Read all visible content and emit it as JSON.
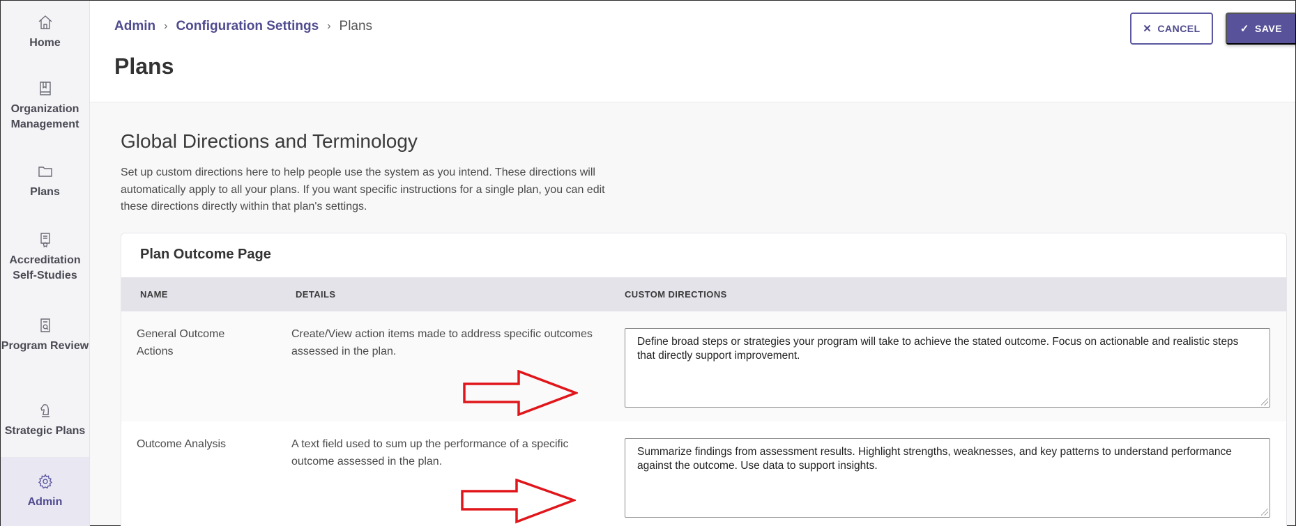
{
  "sidebar": {
    "items": [
      {
        "label": "Home",
        "icon": "home-icon"
      },
      {
        "label": "Organization Management",
        "icon": "book-icon"
      },
      {
        "label": "Plans",
        "icon": "folder-icon"
      },
      {
        "label": "Accreditation Self-Studies",
        "icon": "certificate-icon"
      },
      {
        "label": "Program Review",
        "icon": "document-search-icon"
      },
      {
        "label": "Strategic Plans",
        "icon": "chess-knight-icon"
      },
      {
        "label": "Admin",
        "icon": "gear-icon",
        "active": true
      }
    ]
  },
  "breadcrumb": {
    "admin": "Admin",
    "config": "Configuration Settings",
    "current": "Plans",
    "separator": "›"
  },
  "header": {
    "title": "Plans",
    "cancel_label": "CANCEL",
    "save_label": "SAVE"
  },
  "section": {
    "title": "Global Directions and Terminology",
    "description": "Set up custom directions here to help people use the system as you intend. These directions will automatically apply to all your plans. If you want specific instructions for a single plan, you can edit these directions directly within that plan's settings."
  },
  "card": {
    "title": "Plan Outcome Page",
    "columns": {
      "name": "NAME",
      "details": "DETAILS",
      "custom": "CUSTOM DIRECTIONS"
    },
    "rows": [
      {
        "name": "General Outcome Actions",
        "details": "Create/View action items made to address specific outcomes assessed in the plan.",
        "custom": "Define broad steps or strategies your program will take to achieve the stated outcome. Focus on actionable and realistic steps that directly support improvement."
      },
      {
        "name": "Outcome Analysis",
        "details": "A text field used to sum up the performance of a specific outcome assessed in the plan.",
        "custom": "Summarize findings from assessment results. Highlight strengths, weaknesses, and key patterns to understand performance against the outcome. Use data to support insights."
      }
    ]
  },
  "colors": {
    "accent": "#57529a",
    "annotation_arrow": "#e0161b"
  }
}
